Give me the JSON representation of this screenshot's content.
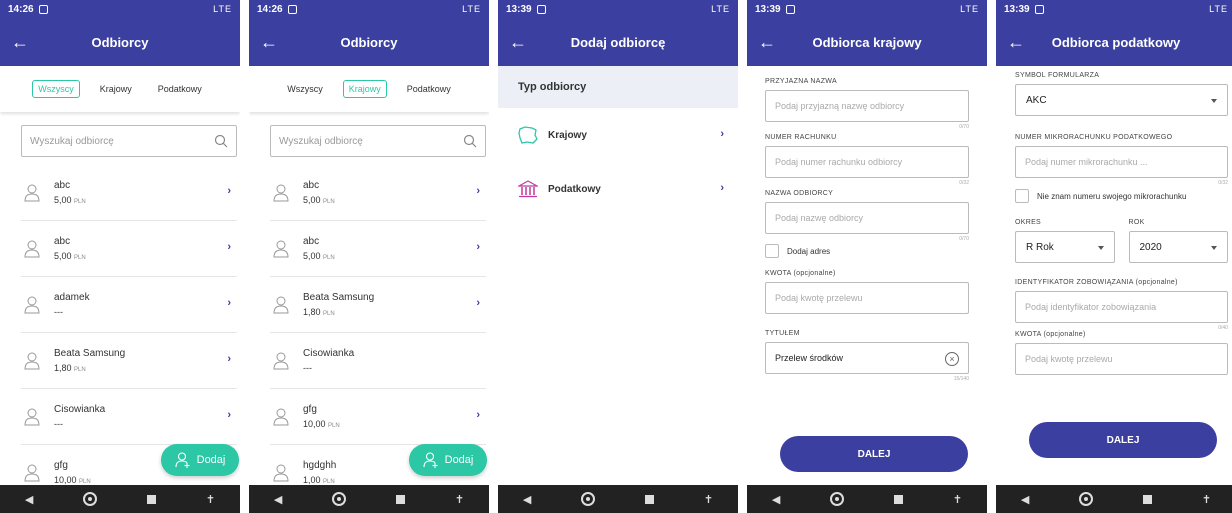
{
  "status_times": [
    "14:26",
    "14:26",
    "13:39",
    "13:39",
    "13:39"
  ],
  "status_network": "LTE",
  "colors": {
    "primary": "#3b3fa0",
    "accent": "#2cc7a5"
  },
  "screen1": {
    "title": "Odbiorcy",
    "tabs": [
      "Wszyscy",
      "Krajowy",
      "Podatkowy"
    ],
    "active_tab": "Wszyscy",
    "search_placeholder": "Wyszukaj odbiorcę",
    "rows": [
      {
        "name": "abc",
        "amount": "5,00",
        "currency": "PLN"
      },
      {
        "name": "abc",
        "amount": "5,00",
        "currency": "PLN"
      },
      {
        "name": "adamek",
        "amount": "---",
        "currency": ""
      },
      {
        "name": "Beata Samsung",
        "amount": "1,80",
        "currency": "PLN"
      },
      {
        "name": "Cisowianka",
        "amount": "---",
        "currency": ""
      },
      {
        "name": "gfg",
        "amount": "10,00",
        "currency": "PLN"
      }
    ],
    "fab_label": "Dodaj"
  },
  "screen2": {
    "title": "Odbiorcy",
    "tabs": [
      "Wszyscy",
      "Krajowy",
      "Podatkowy"
    ],
    "active_tab": "Krajowy",
    "search_placeholder": "Wyszukaj odbiorcę",
    "rows": [
      {
        "name": "abc",
        "amount": "5,00",
        "currency": "PLN"
      },
      {
        "name": "abc",
        "amount": "5,00",
        "currency": "PLN"
      },
      {
        "name": "Beata Samsung",
        "amount": "1,80",
        "currency": "PLN"
      },
      {
        "name": "Cisowianka",
        "amount": "---",
        "currency": ""
      },
      {
        "name": "gfg",
        "amount": "10,00",
        "currency": "PLN"
      },
      {
        "name": "hgdghh",
        "amount": "1,00",
        "currency": "PLN"
      }
    ],
    "fab_label": "Dodaj"
  },
  "screen3": {
    "title": "Dodaj odbiorcę",
    "section": "Typ odbiorcy",
    "types": [
      {
        "label": "Krajowy",
        "icon": "poland-map-icon"
      },
      {
        "label": "Podatkowy",
        "icon": "building-icon"
      }
    ]
  },
  "screen4": {
    "title": "Odbiorca krajowy",
    "fields": [
      {
        "label": "PRZYJAZNA NAZWA",
        "placeholder": "Podaj przyjazną nazwę odbiorcy",
        "counter": "0/70"
      },
      {
        "label": "NUMER RACHUNKU",
        "placeholder": "Podaj numer rachunku odbiorcy",
        "counter": "0/32"
      },
      {
        "label": "NAZWA ODBIORCY",
        "placeholder": "Podaj nazwę odbiorcy",
        "counter": "0/70"
      }
    ],
    "checkbox": "Dodaj adres",
    "amount_label": "KWOTA (opcjonalne)",
    "amount_placeholder": "Podaj kwotę przelewu",
    "title_label": "TYTUŁEM",
    "title_value": "Przelew środków",
    "title_counter": "15/140",
    "button": "DALEJ"
  },
  "screen5": {
    "title": "Odbiorca podatkowy",
    "symbol_label": "SYMBOL FORMULARZA",
    "symbol_value": "AKC",
    "micro_label": "NUMER MIKRORACHUNKU PODATKOWEGO",
    "micro_placeholder": "Podaj numer mikrorachunku ...",
    "micro_counter": "0/32",
    "checkbox": "Nie znam numeru swojego mikrorachunku",
    "period_label": "OKRES",
    "period_value": "R Rok",
    "year_label": "ROK",
    "year_value": "2020",
    "ident_label": "IDENTYFIKATOR ZOBOWIĄZANIA (opcjonalne)",
    "ident_placeholder": "Podaj identyfikator zobowiązania",
    "ident_counter": "0/40",
    "amount_label": "KWOTA (opcjonalne)",
    "amount_placeholder": "Podaj kwotę przelewu",
    "button": "DALEJ"
  }
}
